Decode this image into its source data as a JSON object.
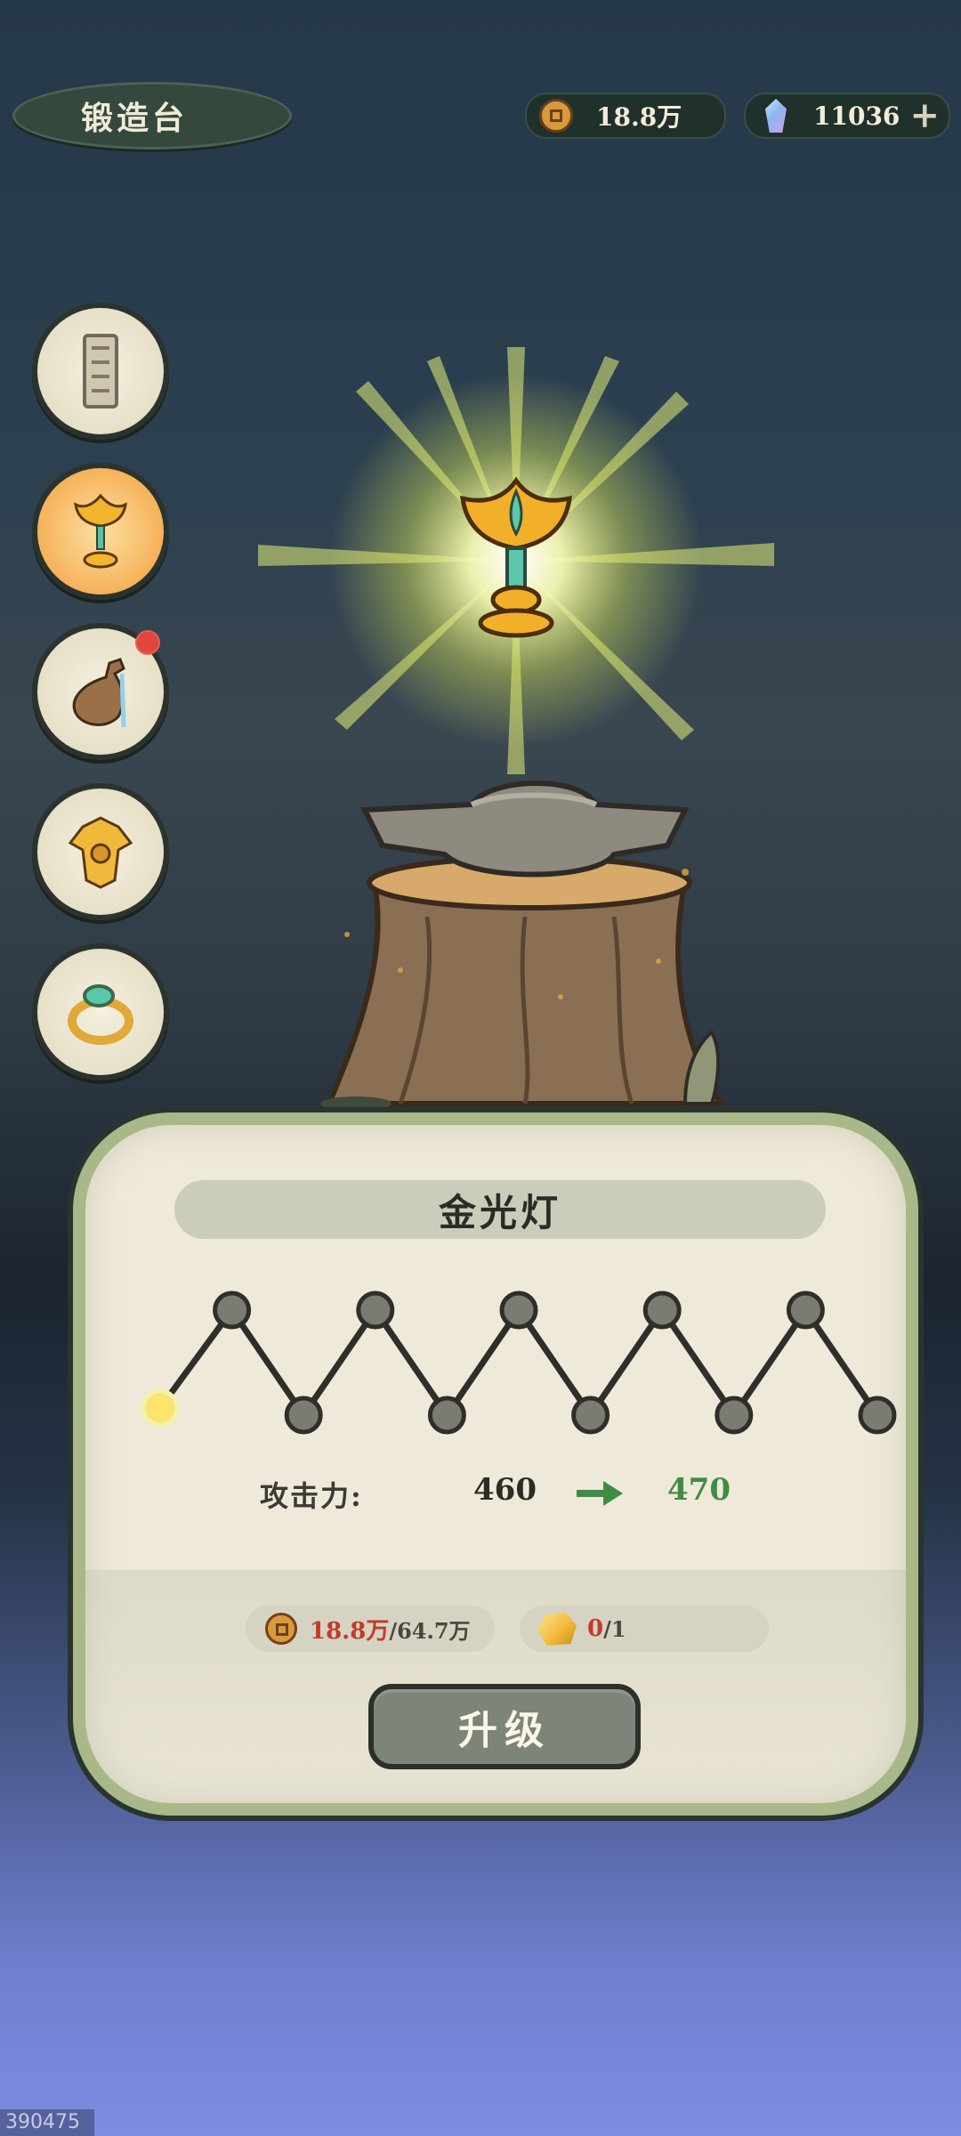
{
  "header": {
    "title": "锻造台",
    "currency": {
      "coins": "18.8万",
      "gems": "11036"
    },
    "icons": {
      "coin": "coin-icon",
      "gem": "gem-icon",
      "add": "plus-icon"
    }
  },
  "item_list": [
    {
      "name": "tablet",
      "icon": "stone-tablet-icon",
      "selected": false,
      "badge": false
    },
    {
      "name": "lotus-lamp",
      "icon": "lotus-lamp-icon",
      "selected": true,
      "badge": false
    },
    {
      "name": "gourd",
      "icon": "gourd-icon",
      "selected": false,
      "badge": true
    },
    {
      "name": "armor",
      "icon": "armor-icon",
      "selected": false,
      "badge": false
    },
    {
      "name": "ring",
      "icon": "jade-ring-icon",
      "selected": false,
      "badge": false
    }
  ],
  "panel": {
    "item_name": "金光灯",
    "upgrade_path": {
      "total_nodes": 11,
      "current_level": 1
    },
    "stat": {
      "label": "攻击力:",
      "current": "460",
      "next": "470"
    },
    "costs": {
      "gold": {
        "have": "18.8万",
        "need": "/64.7万"
      },
      "material": {
        "have": "0",
        "need": "/1"
      }
    },
    "upgrade_button": "升级"
  },
  "watermark": "390475",
  "colors": {
    "accent_green": "#3f8c43",
    "insufficient_red": "#c23a2c",
    "panel_border": "#a8b889",
    "selected_slot": "#f5b25a"
  }
}
